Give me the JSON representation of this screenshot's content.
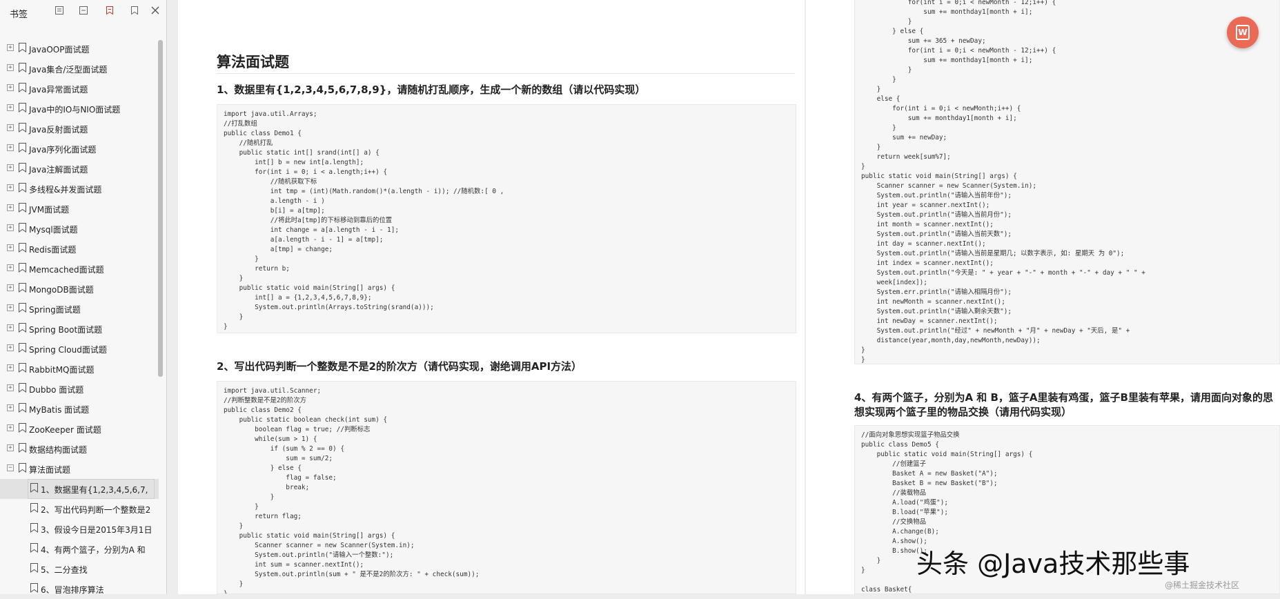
{
  "sidebar": {
    "title": "书签",
    "items": [
      {
        "label": "JavaOOP面试题",
        "expand": "+"
      },
      {
        "label": "Java集合/泛型面试题",
        "expand": "+"
      },
      {
        "label": "Java异常面试题",
        "expand": "+"
      },
      {
        "label": "Java中的IO与NIO面试题",
        "expand": "+"
      },
      {
        "label": "Java反射面试题",
        "expand": "+"
      },
      {
        "label": "Java序列化面试题",
        "expand": "+"
      },
      {
        "label": "Java注解面试题",
        "expand": "+"
      },
      {
        "label": "多线程&并发面试题",
        "expand": "+"
      },
      {
        "label": "JVM面试题",
        "expand": "+"
      },
      {
        "label": "Mysql面试题",
        "expand": "+"
      },
      {
        "label": "Redis面试题",
        "expand": "+"
      },
      {
        "label": "Memcached面试题",
        "expand": "+"
      },
      {
        "label": "MongoDB面试题",
        "expand": "+"
      },
      {
        "label": "Spring面试题",
        "expand": "+"
      },
      {
        "label": "Spring Boot面试题",
        "expand": "+"
      },
      {
        "label": "Spring Cloud面试题",
        "expand": "+"
      },
      {
        "label": "RabbitMQ面试题",
        "expand": "+"
      },
      {
        "label": "Dubbo 面试题",
        "expand": "+"
      },
      {
        "label": "MyBatis 面试题",
        "expand": "+"
      },
      {
        "label": "ZooKeeper 面试题",
        "expand": "+"
      },
      {
        "label": "数据结构面试题",
        "expand": "+"
      },
      {
        "label": "算法面试题",
        "expand": "−"
      }
    ],
    "children": [
      {
        "label": "1、数据里有{1,2,3,4,5,6,7,",
        "selected": true
      },
      {
        "label": "2、写出代码判断一个整数是2",
        "selected": false
      },
      {
        "label": "3、假设今日是2015年3月1日:",
        "selected": false
      },
      {
        "label": "4、有两个篮子，分别为A 和",
        "selected": false
      },
      {
        "label": "5、二分查找",
        "selected": false
      },
      {
        "label": "6、冒泡排序算法",
        "selected": false
      }
    ]
  },
  "page1": {
    "title": "算法面试题",
    "q1": "1、数据里有{1,2,3,4,5,6,7,8,9}，请随机打乱顺序，生成一个新的数组（请以代码实现）",
    "code1": "import java.util.Arrays;\n//打乱数组\npublic class Demo1 {\n    //随机打乱\n    public static int[] srand(int[] a) {\n        int[] b = new int[a.length];\n        for(int i = 0; i < a.length;i++) {\n            //随机获取下标\n            int tmp = (int)(Math.random()*(a.length - i)); //随机数:[ 0 ,\n            a.length - i )\n            b[i] = a[tmp];\n            //将此时a[tmp]的下标移动到靠后的位置\n            int change = a[a.length - i - 1];\n            a[a.length - i - 1] = a[tmp];\n            a[tmp] = change;\n        }\n        return b;\n    }\n    public static void main(String[] args) {\n        int[] a = {1,2,3,4,5,6,7,8,9};\n        System.out.println(Arrays.toString(srand(a)));\n    }\n}",
    "q2": "2、写出代码判断一个整数是不是2的阶次方（请代码实现，谢绝调用API方法）",
    "code2": "import java.util.Scanner;\n//判断整数是不是2的阶次方\npublic class Demo2 {\n    public static boolean check(int sum) {\n        boolean flag = true; //判断标志\n        while(sum > 1) {\n            if (sum % 2 == 0) {\n                sum = sum/2;\n            } else {\n                flag = false;\n                break;\n            }\n        }\n        return flag;\n    }\n    public static void main(String[] args) {\n        Scanner scanner = new Scanner(System.in);\n        System.out.println(\"请输入一个整数:\");\n        int sum = scanner.nextInt();\n        System.out.println(sum + \" 是不是2的阶次方: \" + check(sum));\n    }\n}"
  },
  "page2": {
    "code3": "            for(int i = 0;i < newMonth - 12;i++) {\n                sum += monthday1[month + i];\n            }\n        } else {\n            sum += 365 + newDay;\n            for(int i = 0;i < newMonth - 12;i++) {\n                sum += monthday1[month + i];\n            }\n        }\n    }\n    else {\n        for(int i = 0;i < newMonth;i++) {\n            sum += monthday1[month + i];\n        }\n        sum += newDay;\n    }\n    return week[sum%7];\n}\npublic static void main(String[] args) {\n    Scanner scanner = new Scanner(System.in);\n    System.out.println(\"请输入当前年份\");\n    int year = scanner.nextInt();\n    System.out.println(\"请输入当前月份\");\n    int month = scanner.nextInt();\n    System.out.println(\"请输入当前天数\");\n    int day = scanner.nextInt();\n    System.out.println(\"请输入当前是星期几; 以数字表示, 如: 星期天 为 0\");\n    int index = scanner.nextInt();\n    System.out.println(\"今天是: \" + year + \"-\" + month + \"-\" + day + \" \" +\n    week[index]);\n    System.err.println(\"请输入相隔月份\");\n    int newMonth = scanner.nextInt();\n    System.out.println(\"请输入剩余天数\");\n    int newDay = scanner.nextInt();\n    System.out.println(\"经过\" + newMonth + \"月\" + newDay + \"天后, 是\" +\n    distance(year,month,day,newMonth,newDay));\n}\n}",
    "q4": "4、有两个篮子，分别为A 和 B，篮子A里装有鸡蛋，篮子B里装有苹果，请用面向对象的思想实现两个篮子里的物品交换（请用代码实现）",
    "code4": "//面向对象思想实现篮子物品交换\npublic class Demo5 {\n    public static void main(String[] args) {\n        //创建篮子\n        Basket A = new Basket(\"A\");\n        Basket B = new Basket(\"B\");\n        //装载物品\n        A.load(\"鸡蛋\");\n        B.load(\"苹果\");\n        //交换物品\n        A.change(B);\n        A.show();\n        B.show();\n    }\n}\n\nclass Basket{"
  },
  "watermark": {
    "main": "头条 @Java技术那些事",
    "sub": "@稀土掘金技术社区"
  },
  "fab": {
    "icon": "wps-convert-icon",
    "glyph": "W"
  }
}
